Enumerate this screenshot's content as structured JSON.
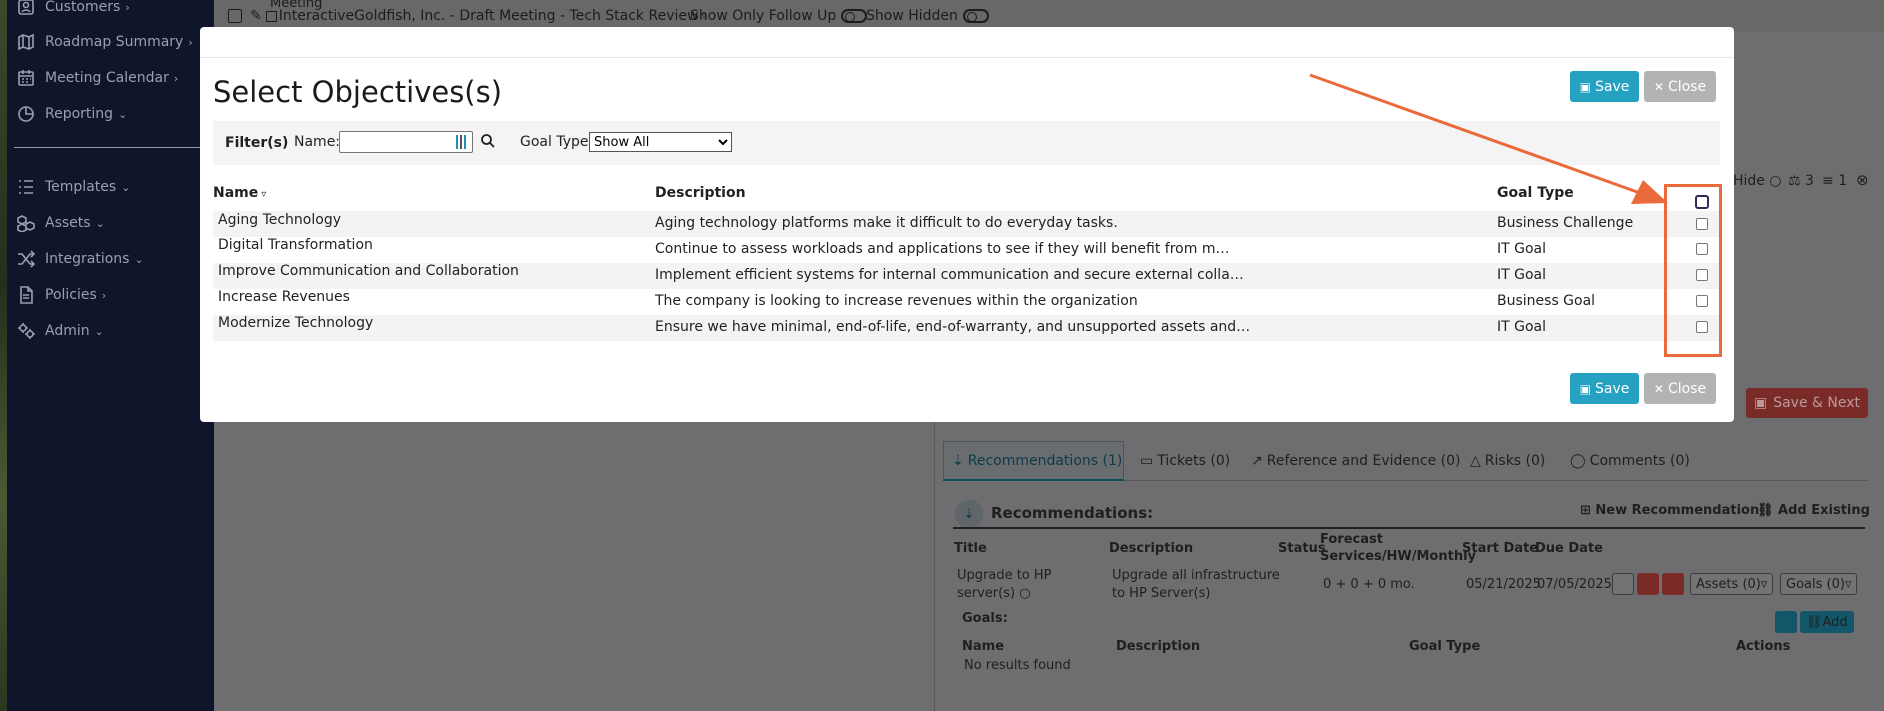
{
  "sidebar": {
    "items": [
      {
        "label": "Customers",
        "chev": "›",
        "icon": "customers-icon"
      },
      {
        "label": "Roadmap Summary",
        "chev": "›",
        "icon": "map-icon"
      },
      {
        "label": "Meeting Calendar",
        "chev": "›",
        "icon": "calendar-icon"
      },
      {
        "label": "Reporting",
        "chev": "⌄",
        "icon": "pie-chart-icon"
      },
      {
        "label": "Templates",
        "chev": "⌄",
        "icon": "list-icon"
      },
      {
        "label": "Assets",
        "chev": "⌄",
        "icon": "boxes-icon"
      },
      {
        "label": "Integrations",
        "chev": "⌄",
        "icon": "shuffle-icon"
      },
      {
        "label": "Policies",
        "chev": "›",
        "icon": "document-icon"
      },
      {
        "label": "Admin",
        "chev": "⌄",
        "icon": "gears-icon"
      }
    ]
  },
  "topbar": {
    "meeting_label": "Meeting",
    "meeting_title": "InteractiveGoldfish, Inc. - Draft Meeting - Tech Stack Review",
    "show_follow_up": "Show Only Follow Up",
    "show_hidden": "Show Hidden"
  },
  "background_panel": {
    "hide_label": "Hide",
    "count_a": "3",
    "count_b": "1",
    "save_next": "Save & Next",
    "tabs": [
      "Recommendations (1)",
      "Tickets (0)",
      "Reference and Evidence (0)",
      "Risks (0)",
      "Comments (0)"
    ],
    "recommendations_title": "Recommendations:",
    "new_recommendation": "New Recommendation",
    "add_existing": "Add Existing",
    "rec_headers": {
      "title": "Title",
      "description": "Description",
      "status": "Status",
      "forecast": "Forecast",
      "forecast2": "Services/HW/Monthly",
      "start": "Start Date",
      "due": "Due Date"
    },
    "rec_row": {
      "title1": "Upgrade to HP",
      "title2": "server(s)",
      "desc1": "Upgrade all infrastructure",
      "desc2": "to HP Server(s)",
      "forecast": "0 + 0 + 0 mo.",
      "start": "05/21/2025",
      "due": "07/05/2025",
      "assets": "Assets (0)",
      "goals": "Goals (0)"
    },
    "goals_label": "Goals:",
    "add_label": "Add",
    "goals_headers": {
      "name": "Name",
      "description": "Description",
      "goal_type": "Goal Type",
      "actions": "Actions"
    },
    "no_results": "No results found"
  },
  "modal": {
    "title": "Select Objectives(s)",
    "save_label": "Save",
    "close_label": "Close",
    "filter": {
      "label": "Filter(s)",
      "name_label": "Name:",
      "name_value": "",
      "goal_type_label": "Goal Type:",
      "goal_type_selected": "Show All"
    },
    "columns": {
      "name": "Name",
      "description": "Description",
      "goal_type": "Goal Type"
    },
    "rows": [
      {
        "name": "Aging Technology",
        "description": "Aging technology platforms make it difficult to do everyday tasks.",
        "goal_type": "Business Challenge"
      },
      {
        "name": "Digital Transformation",
        "description": "Continue to assess workloads and applications to see if they will benefit from m…",
        "goal_type": "IT Goal"
      },
      {
        "name": "Improve Communication and Collaboration",
        "description": "Implement efficient systems for internal communication and secure external colla…",
        "goal_type": "IT Goal"
      },
      {
        "name": "Increase Revenues",
        "description": "The company is looking to increase revenues within the organization",
        "goal_type": "Business Goal"
      },
      {
        "name": "Modernize Technology",
        "description": "Ensure we have minimal, end-of-life, end-of-warranty, and unsupported assets and…",
        "goal_type": "IT Goal"
      }
    ]
  },
  "colors": {
    "accent": "#25a1c2",
    "close_button": "#b3b3b3",
    "annotation": "#ea6a3b",
    "sidebar_bg": "#0f152b"
  }
}
